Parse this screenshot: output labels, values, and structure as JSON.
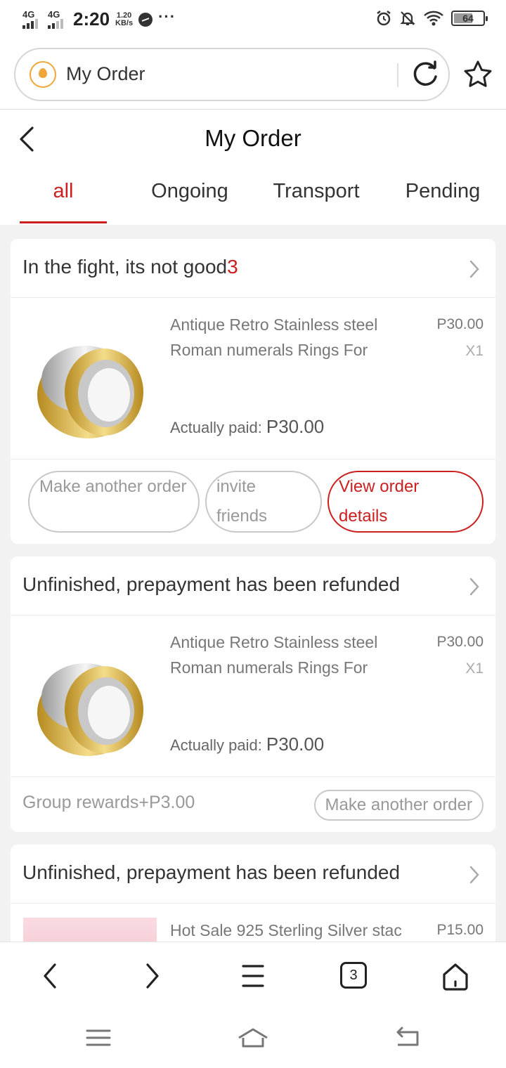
{
  "status_bar": {
    "network_1": "4G",
    "network_2": "4G",
    "time": "2:20",
    "speed_value": "1.20",
    "speed_unit": "KB/s",
    "battery": "64",
    "icons": [
      "messenger-icon",
      "more-dots-icon",
      "alarm-icon",
      "mute-bell-icon",
      "wifi-icon",
      "battery-icon"
    ]
  },
  "address_bar": {
    "url_text": "My Order",
    "site_icon": "droplet-logo-icon",
    "reload_icon": "reload-icon",
    "bookmark_icon": "star-icon"
  },
  "header": {
    "title": "My Order",
    "back_icon": "chevron-left-icon"
  },
  "tabs": [
    {
      "label": "all",
      "active": true
    },
    {
      "label": "Ongoing",
      "active": false
    },
    {
      "label": "Transport",
      "active": false
    },
    {
      "label": "Pending",
      "active": false
    }
  ],
  "orders": [
    {
      "status_text": "In the fight, its not good",
      "status_count": "3",
      "product_name": "Antique Retro Stainless steel Roman numerals Rings For Wom···",
      "price": "P30.00",
      "quantity": "X1",
      "paid_label": "Actually paid:",
      "paid_amount": "P30.00",
      "actions": [
        "Make another order",
        "invite friends",
        "View order details"
      ]
    },
    {
      "status_text": "Unfinished, prepayment has been refunded",
      "product_name": "Antique Retro Stainless steel Roman numerals Rings For Wom···",
      "price": "P30.00",
      "quantity": "X1",
      "paid_label": "Actually paid:",
      "paid_amount": "P30.00",
      "reward": "Group rewards+P3.00",
      "action": "Make another order"
    },
    {
      "status_text": "Unfinished, prepayment has been refunded",
      "product_name": "Hot Sale 925 Sterling Silver stac",
      "price": "P15.00"
    }
  ],
  "bottom_bar": {
    "tab_count": "3",
    "icons": [
      "back-icon",
      "forward-icon",
      "menu-icon",
      "tabs-icon",
      "home-icon"
    ]
  },
  "system_nav": {
    "icons": [
      "recent-apps-icon",
      "home-nav-icon",
      "back-nav-icon"
    ]
  },
  "colors": {
    "accent_red": "#cc1f1f",
    "site_orange": "#f0a63b",
    "page_bg": "#f2f2f2"
  }
}
